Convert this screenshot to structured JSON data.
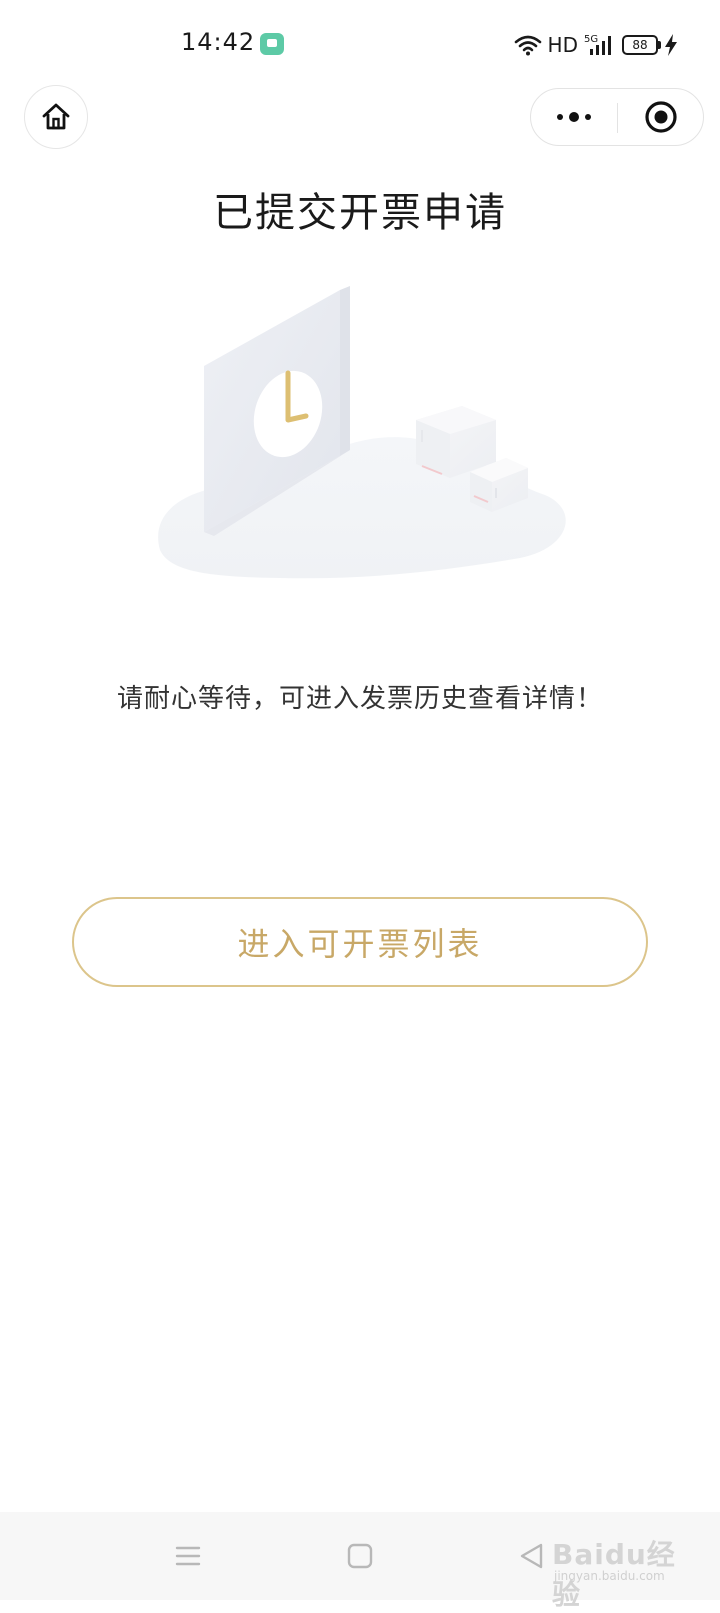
{
  "status_bar": {
    "time": "14:42",
    "network_label": "HD",
    "signal_label": "5G",
    "battery_level": "88",
    "icons": [
      "message-app-icon",
      "wifi-icon",
      "signal-icon",
      "battery-icon",
      "charging-icon"
    ]
  },
  "top_nav": {
    "home_icon": "home-icon",
    "more_icon": "more-dots-icon",
    "close_icon": "target-close-icon"
  },
  "page": {
    "title": "已提交开票申请",
    "message": "请耐心等待，可进入发票历史查看详情！",
    "primary_button_label": "进入可开票列表"
  },
  "colors": {
    "accent": "#c8a867",
    "accent_border": "#dcc58b",
    "status_app": "#5dcaa6"
  },
  "bottom_nav": {
    "icons": [
      "menu-icon",
      "square-home-icon",
      "back-triangle-icon"
    ]
  },
  "watermark": {
    "text": "Baidu经验",
    "sub": "jingyan.baidu.com"
  }
}
